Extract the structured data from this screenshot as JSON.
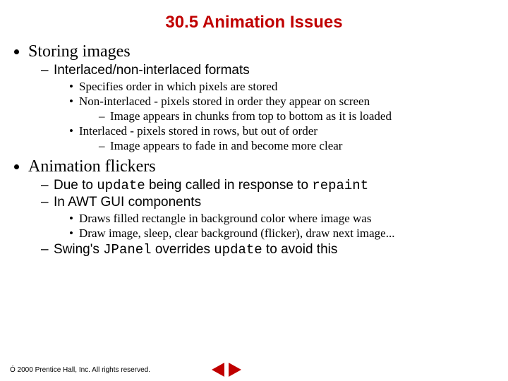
{
  "title": "30.5  Animation Issues",
  "b1": {
    "t": "Storing images",
    "s1": {
      "t": "Interlaced/non-interlaced formats",
      "c1": "Specifies order in which pixels are stored",
      "c2": "Non-interlaced - pixels stored in order they appear on screen",
      "c2d1": "Image appears in chunks from top to bottom as it is loaded",
      "c3": "Interlaced - pixels stored in rows, but out of order",
      "c3d1": "Image appears to fade in and become more clear"
    }
  },
  "b2": {
    "t": "Animation flickers",
    "s1a": "Due to ",
    "s1b": "update",
    "s1c": " being called in response to ",
    "s1d": "repaint",
    "s2": {
      "t": "In AWT GUI components",
      "c1": "Draws filled rectangle in background color where image was",
      "c2": "Draw image, sleep, clear background (flicker), draw next image..."
    },
    "s3a": "Swing's ",
    "s3b": "JPanel",
    "s3c": " overrides ",
    "s3d": "update",
    "s3e": " to avoid this"
  },
  "footer": "Ó 2000 Prentice Hall, Inc.  All rights reserved."
}
